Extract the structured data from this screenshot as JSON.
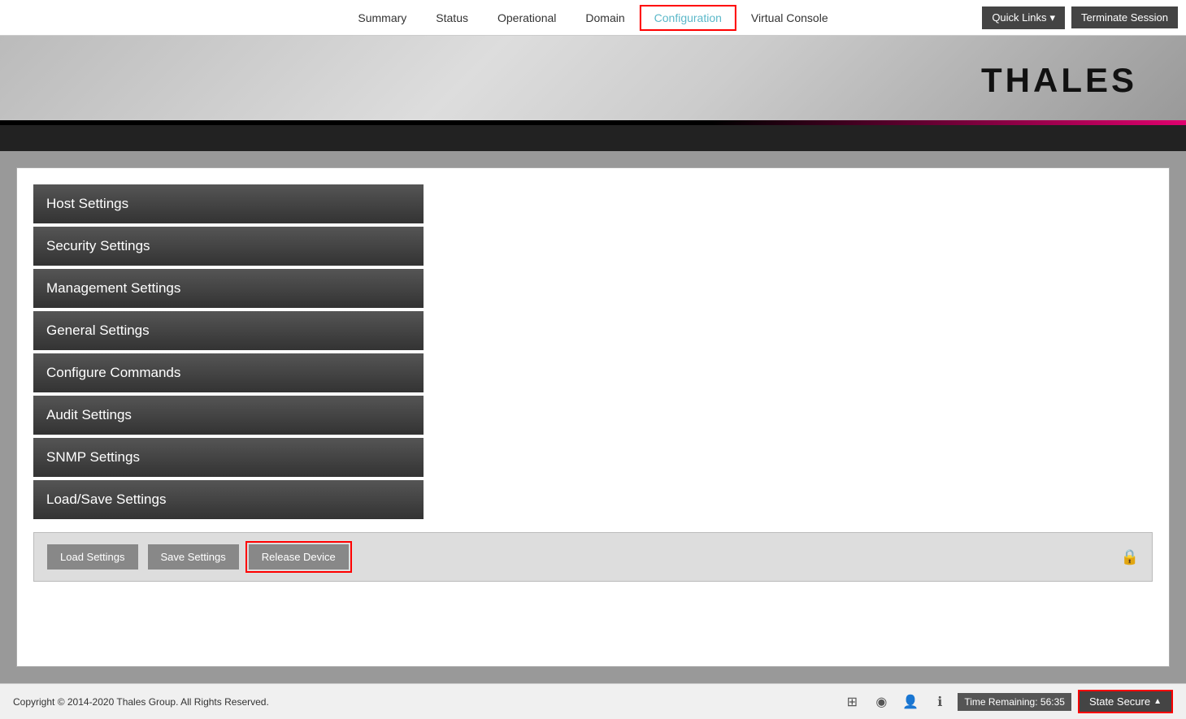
{
  "nav": {
    "items": [
      {
        "label": "Summary",
        "active": false
      },
      {
        "label": "Status",
        "active": false
      },
      {
        "label": "Operational",
        "active": false
      },
      {
        "label": "Domain",
        "active": false
      },
      {
        "label": "Configuration",
        "active": true
      },
      {
        "label": "Virtual Console",
        "active": false
      }
    ],
    "quick_links_label": "Quick Links",
    "terminate_label": "Terminate Session"
  },
  "header": {
    "logo_text": "THALES"
  },
  "sidebar": {
    "items": [
      {
        "label": "Host Settings"
      },
      {
        "label": "Security Settings"
      },
      {
        "label": "Management Settings"
      },
      {
        "label": "General Settings"
      },
      {
        "label": "Configure Commands"
      },
      {
        "label": "Audit Settings"
      },
      {
        "label": "SNMP Settings"
      },
      {
        "label": "Load/Save Settings"
      }
    ]
  },
  "actions": {
    "load_label": "Load Settings",
    "save_label": "Save Settings",
    "release_label": "Release Device"
  },
  "footer": {
    "copyright": "Copyright © 2014-2020 Thales Group. All Rights Reserved.",
    "time_remaining": "Time Remaining: 56:35",
    "state_label": "State Secure"
  }
}
